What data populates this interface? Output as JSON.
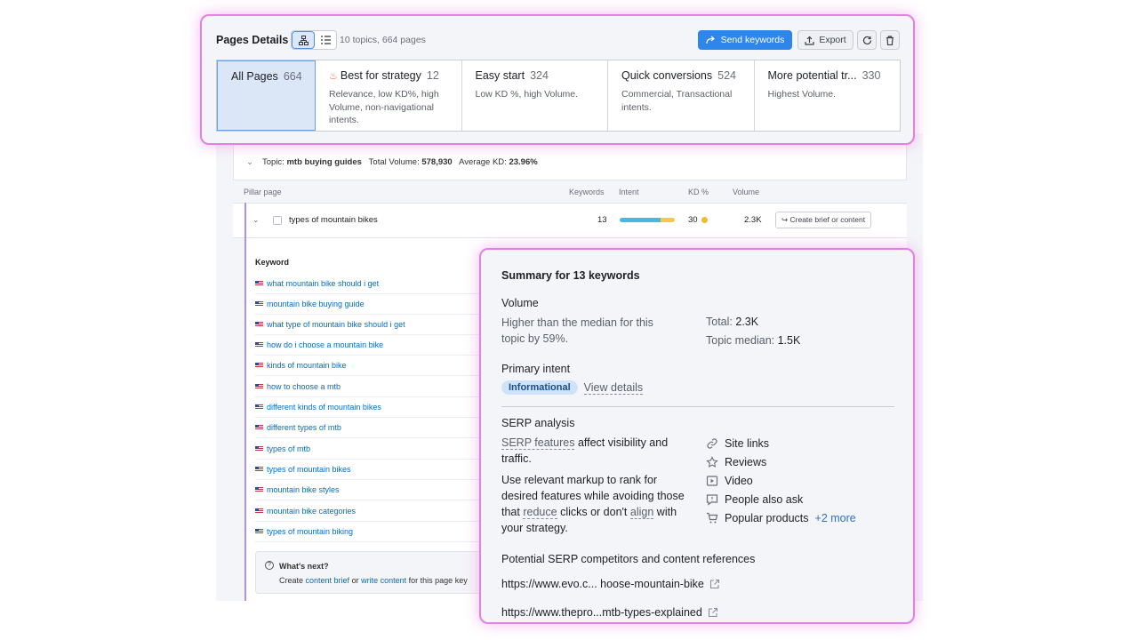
{
  "header": {
    "title": "Pages Details",
    "count_text": "10 topics, 664 pages",
    "send_label": "Send keywords",
    "export_label": "Export"
  },
  "tabs": [
    {
      "name": "All Pages",
      "count": "664",
      "desc": ""
    },
    {
      "name": "Best for strategy",
      "count": "12",
      "desc": "Relevance, low KD%, high Volume, non-navigational intents."
    },
    {
      "name": "Easy start",
      "count": "324",
      "desc": "Low KD %, high Volume."
    },
    {
      "name": "Quick conversions",
      "count": "524",
      "desc": "Commercial, Transactional intents."
    },
    {
      "name": "More potential tr...",
      "count": "330",
      "desc": "Highest Volume."
    }
  ],
  "topic": {
    "label": "Topic:",
    "name": "mtb buying guides",
    "volume_label": "Total Volume:",
    "volume": "578,930",
    "kd_label": "Average KD:",
    "kd": "23.96%"
  },
  "columns": {
    "pillar": "Pillar page",
    "keywords": "Keywords",
    "intent": "Intent",
    "kd": "KD %",
    "volume": "Volume"
  },
  "pillar_row": {
    "name": "types of mountain bikes",
    "keywords": "13",
    "kd": "30",
    "volume": "2.3K",
    "brief_label": "Create brief or content"
  },
  "keyword_list": {
    "header": "Keyword",
    "items": [
      "what mountain bike should i get",
      "mountain bike buying guide",
      "what type of mountain bike should i get",
      "how do i choose a mountain bike",
      "kinds of mountain bike",
      "how to choose a mtb",
      "different kinds of mountain bikes",
      "different types of mtb",
      "types of mtb",
      "types of mountain bikes",
      "mountain bike styles",
      "mountain bike categories",
      "types of mountain biking"
    ]
  },
  "whats_next": {
    "title": "What's next?",
    "prefix": "Create",
    "link1": "content brief",
    "or": "or",
    "link2": "write content",
    "suffix": "for this page key"
  },
  "summary": {
    "title": "Summary for 13 keywords",
    "volume_heading": "Volume",
    "volume_text": "Higher than the median for this topic by 59%.",
    "total_label": "Total:",
    "total_value": "2.3K",
    "median_label": "Topic median:",
    "median_value": "1.5K",
    "intent_heading": "Primary intent",
    "intent_badge": "Informational",
    "view_details": "View details",
    "serp_heading": "SERP analysis",
    "serp_link": "SERP features",
    "serp_text1": "affect visibility and traffic.",
    "serp_p2_a": "Use relevant markup to rank for desired features while avoiding those that",
    "serp_p2_reduce": "reduce",
    "serp_p2_b": "clicks or don't",
    "serp_p2_align": "align",
    "serp_p2_c": "with your strategy.",
    "features": [
      {
        "label": "Site links",
        "icon": "link-icon"
      },
      {
        "label": "Reviews",
        "icon": "star-icon"
      },
      {
        "label": "Video",
        "icon": "video-icon"
      },
      {
        "label": "People also ask",
        "icon": "question-icon"
      },
      {
        "label": "Popular products",
        "icon": "cart-icon"
      }
    ],
    "more_label": "+2 more",
    "competitors_heading": "Potential SERP competitors and content references",
    "urls": [
      "https://www.evo.c... hoose-mountain-bike",
      "https://www.thepro...mtb-types-explained"
    ]
  },
  "colors": {
    "accent": "#2f86ea",
    "highlight_border": "#e57fe0",
    "link": "#006dca"
  }
}
